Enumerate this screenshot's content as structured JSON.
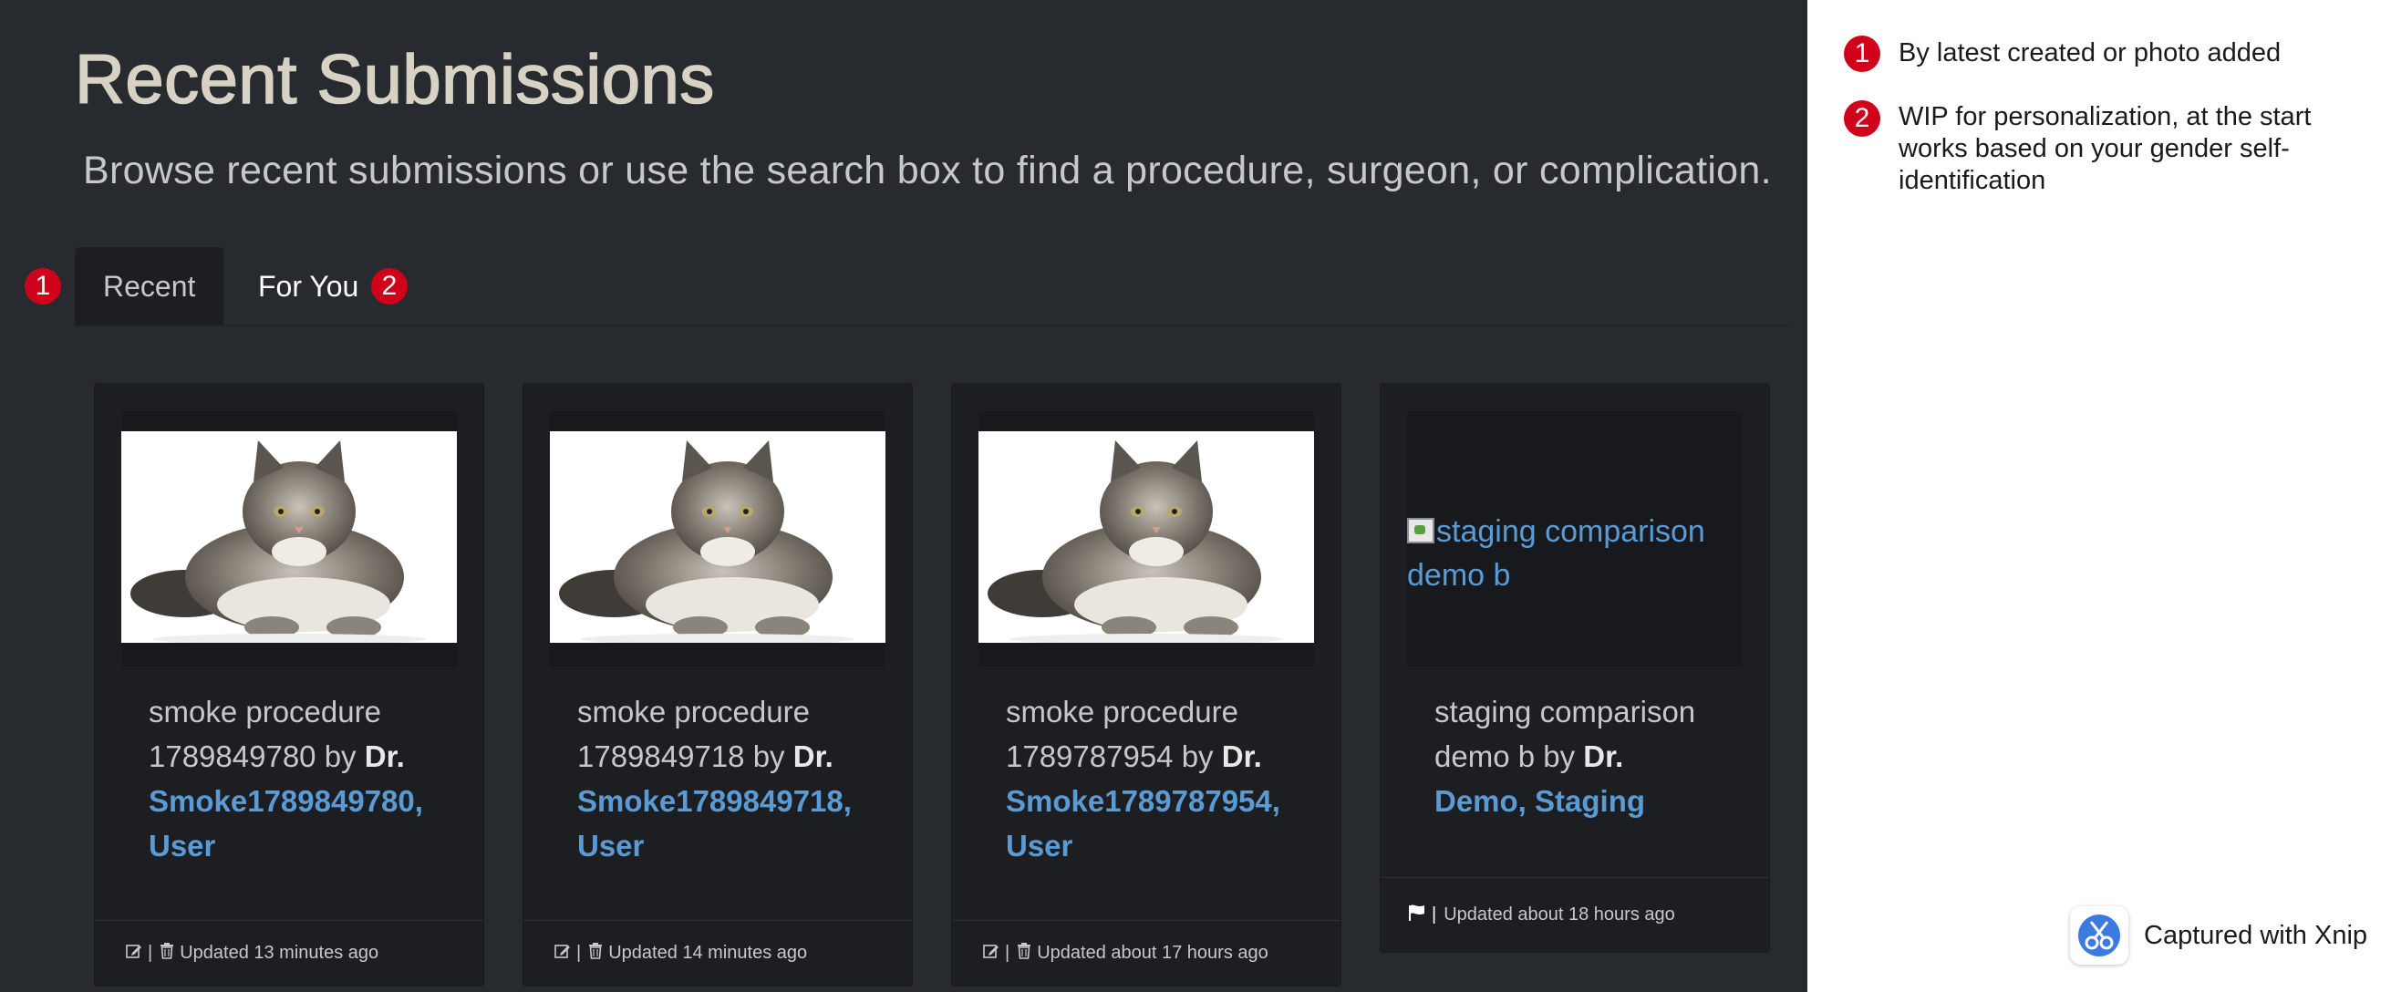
{
  "header": {
    "title": "Recent Submissions",
    "subtitle": "Browse recent submissions or use the search box to find a procedure, surgeon, or complication."
  },
  "tabs": [
    {
      "label": "Recent",
      "badge": "1",
      "active": true
    },
    {
      "label": "For You",
      "badge": "2",
      "active": false
    }
  ],
  "cards": [
    {
      "image": "cat-photo",
      "title": "smoke procedure 1789849780",
      "by": "by",
      "dr": "Dr.",
      "surgeon": "Smoke1789849780, User",
      "footer": "Updated 13 minutes ago",
      "footer_icons": [
        "edit-icon",
        "trash-icon"
      ]
    },
    {
      "image": "cat-photo",
      "title": "smoke procedure 1789849718",
      "by": "by",
      "dr": "Dr.",
      "surgeon": "Smoke1789849718, User",
      "footer": "Updated 14 minutes ago",
      "footer_icons": [
        "edit-icon",
        "trash-icon"
      ]
    },
    {
      "image": "cat-photo",
      "title": "smoke procedure 1789787954",
      "by": "by",
      "dr": "Dr.",
      "surgeon": "Smoke1789787954, User",
      "footer": "Updated about 17 hours ago",
      "footer_icons": [
        "edit-icon",
        "trash-icon"
      ]
    },
    {
      "image_alt": "staging comparison demo b",
      "title": "staging comparison demo b",
      "by": "by",
      "dr": "Dr.",
      "surgeon": "Demo, Staging",
      "footer": "Updated about 18 hours ago",
      "footer_icons": [
        "flag-icon"
      ]
    }
  ],
  "notes": [
    {
      "badge": "1",
      "text": "By latest created or photo added"
    },
    {
      "badge": "2",
      "text": "WIP for personalization, at the start works based on your gender self-identification"
    }
  ],
  "capture": {
    "label": "Captured with Xnip",
    "icon": "xnip-scissors-icon"
  },
  "colors": {
    "background": "#272b30",
    "card": "#1c1e22",
    "link": "#5a9bd5",
    "badge": "#d0021b"
  }
}
